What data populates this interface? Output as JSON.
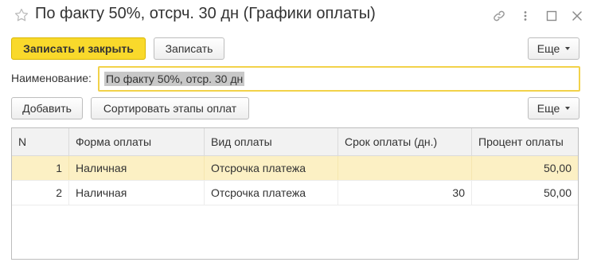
{
  "window": {
    "title": "По факту 50%, отсрч. 30 дн (Графики оплаты)",
    "icons": [
      "star-icon",
      "link-icon",
      "more-vertical-icon",
      "maximize-icon",
      "close-icon"
    ]
  },
  "toolbar": {
    "save_close_label": "Записать и закрыть",
    "save_label": "Записать",
    "more_label": "Еще"
  },
  "name": {
    "label": "Наименование:",
    "value": "По факту 50%, отср. 30 дн"
  },
  "table_toolbar": {
    "add_label": "Добавить",
    "sort_label": "Сортировать этапы оплат",
    "more_label": "Еще"
  },
  "table": {
    "columns": [
      "N",
      "Форма оплаты",
      "Вид оплаты",
      "Срок оплаты (дн.)",
      "Процент оплаты"
    ],
    "rows": [
      {
        "n": "1",
        "form": "Наличная",
        "kind": "Отсрочка платежа",
        "term": "",
        "percent": "50,00",
        "selected": true
      },
      {
        "n": "2",
        "form": "Наличная",
        "kind": "Отсрочка платежа",
        "term": "30",
        "percent": "50,00",
        "selected": false
      }
    ]
  },
  "colors": {
    "primary_button": "#f9d92b",
    "selected_row": "#fcf0c4",
    "focus_border": "#f2d24a"
  }
}
